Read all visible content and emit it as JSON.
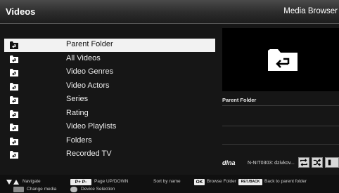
{
  "header": {
    "title": "Videos",
    "breadcrumb": "Media Browser"
  },
  "list": {
    "items": [
      {
        "label": "Parent Folder",
        "selected": true
      },
      {
        "label": "All Videos"
      },
      {
        "label": "Video Genres"
      },
      {
        "label": "Video Actors"
      },
      {
        "label": "Series"
      },
      {
        "label": "Rating"
      },
      {
        "label": "Video Playlists"
      },
      {
        "label": "Folders"
      },
      {
        "label": "Recorded TV"
      }
    ]
  },
  "info": {
    "title": "Parent Folder"
  },
  "device": {
    "logo": "dlna",
    "name": "N-NIT0303: dzivkov..."
  },
  "footer": {
    "navigate": "Navigate",
    "page_keys": "P+  P-",
    "page": "Page UP/DOWN",
    "sort": "Sort by name",
    "ok_key": "OK",
    "browse": "Browse Folder",
    "back_key": "RET./BACK",
    "back": "Back to parent folder",
    "change_media": "Change media",
    "device_selection": "Device Selection"
  },
  "colors": {
    "selected_row": "#f2f2f2",
    "background": "#161616"
  }
}
